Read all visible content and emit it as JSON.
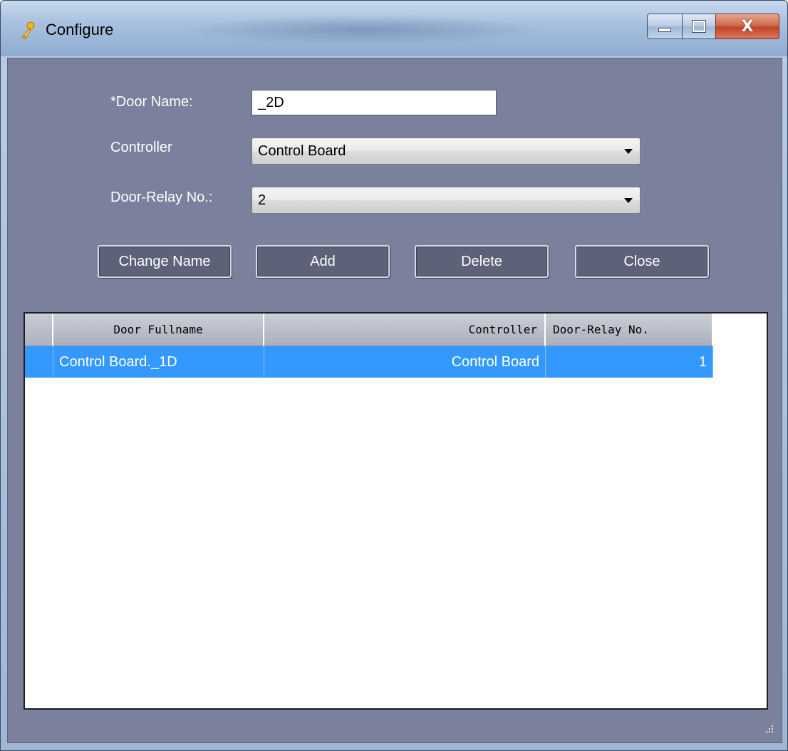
{
  "window": {
    "title": "Configure",
    "controls": {
      "minimize": "—",
      "maximize": "▫",
      "close": "X"
    }
  },
  "form": {
    "door_name_label": "*Door Name:",
    "door_name_value": "_2D",
    "controller_label": "Controller",
    "controller_value": "Control Board",
    "relay_label": "Door-Relay No.:",
    "relay_value": "2"
  },
  "buttons": {
    "change_name": "Change Name",
    "add": "Add",
    "delete": "Delete",
    "close": "Close"
  },
  "table": {
    "columns": [
      "Door Fullname",
      "Controller",
      "Door-Relay No."
    ],
    "rows": [
      {
        "door_fullname": "Control Board._1D",
        "controller": "Control Board",
        "door_relay_no": "1",
        "selected": true
      }
    ]
  },
  "colors": {
    "client_bg": "#7b809c",
    "selection": "#3399ff",
    "button_bg": "#5d6279"
  }
}
